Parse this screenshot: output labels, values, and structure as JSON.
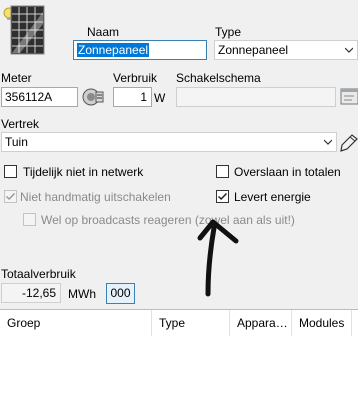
{
  "labels": {
    "naam": "Naam",
    "type": "Type",
    "meter": "Meter",
    "verbruik": "Verbruik",
    "schakelschema": "Schakelschema",
    "vertrek": "Vertrek",
    "totaalverbruik": "Totaalverbruik"
  },
  "fields": {
    "naam_value": "Zonnepaneel",
    "type_value": "Zonnepaneel",
    "meter_value": "356112A",
    "verbruik_value": "1",
    "verbruik_unit": "W",
    "schakelschema_value": "",
    "vertrek_value": "Tuin",
    "totaal_value": "-12,65",
    "totaal_unit": "MWh",
    "totaal_button": "000"
  },
  "checkboxes": {
    "tijdelijk": {
      "label": "Tijdelijk niet in netwerk",
      "checked": false
    },
    "overslaan": {
      "label": "Overslaan in totalen",
      "checked": false
    },
    "niet_handmatig": {
      "label": "Niet handmatig uitschakelen",
      "checked": true
    },
    "levert": {
      "label": "Levert energie",
      "checked": true
    },
    "broadcast": {
      "label": "Wel op broadcasts reageren (zowel aan als uit!)",
      "checked": false
    }
  },
  "table": {
    "columns": [
      "Groep",
      "Type",
      "Appara…",
      "Modules"
    ]
  },
  "icons": {
    "device": "solar-panel-icon",
    "meter": "meter-icon",
    "schakelschema": "diagram-icon",
    "vertrek": "edit-icon"
  },
  "colors": {
    "selection": "#0078d7",
    "window": "#f0f0f0"
  }
}
